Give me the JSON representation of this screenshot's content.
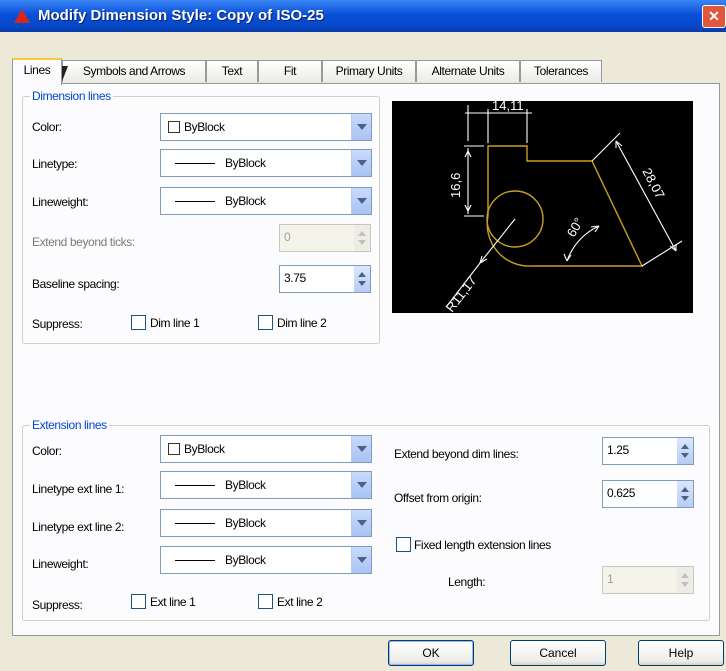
{
  "window": {
    "title": "Modify Dimension Style: Copy of ISO-25",
    "close_icon": "close-icon"
  },
  "tabs": [
    {
      "label": "Lines",
      "active": true
    },
    {
      "label": "Symbols and Arrows"
    },
    {
      "label": "Text"
    },
    {
      "label": "Fit"
    },
    {
      "label": "Primary Units"
    },
    {
      "label": "Alternate Units"
    },
    {
      "label": "Tolerances"
    }
  ],
  "dimension_lines": {
    "group_label": "Dimension lines",
    "color": {
      "label": "Color:",
      "value": "ByBlock"
    },
    "linetype": {
      "label": "Linetype:",
      "value": "ByBlock"
    },
    "lineweight": {
      "label": "Lineweight:",
      "value": "ByBlock"
    },
    "extend_beyond_ticks": {
      "label": "Extend beyond ticks:",
      "value": "0"
    },
    "baseline_spacing": {
      "label": "Baseline spacing:",
      "value": "3.75"
    },
    "suppress": {
      "label": "Suppress:",
      "dim_line_1": "Dim line 1",
      "dim_line_2": "Dim line 2"
    }
  },
  "preview": {
    "dim_top": "14,11",
    "dim_left": "16,6",
    "dim_right": "28,07",
    "dim_angle": "60°",
    "dim_radius": "R11,17",
    "colors": {
      "geometry": "#c8a022",
      "dimensions": "#ffffff",
      "background": "#000000"
    }
  },
  "extension_lines": {
    "group_label": "Extension lines",
    "color": {
      "label": "Color:",
      "value": "ByBlock"
    },
    "linetype_ext_1": {
      "label": "Linetype ext line 1:",
      "value": "ByBlock"
    },
    "linetype_ext_2": {
      "label": "Linetype ext line 2:",
      "value": "ByBlock"
    },
    "lineweight": {
      "label": "Lineweight:",
      "value": "ByBlock"
    },
    "suppress": {
      "label": "Suppress:",
      "ext_line_1": "Ext line 1",
      "ext_line_2": "Ext line 2"
    },
    "extend_beyond_dim": {
      "label": "Extend beyond dim lines:",
      "value": "1.25"
    },
    "offset_from_origin": {
      "label": "Offset from origin:",
      "value": "0.625"
    },
    "fixed_length": {
      "label": "Fixed length extension lines"
    },
    "length": {
      "label": "Length:",
      "value": "1"
    }
  },
  "buttons": {
    "ok": "OK",
    "cancel": "Cancel",
    "help": "Help"
  }
}
